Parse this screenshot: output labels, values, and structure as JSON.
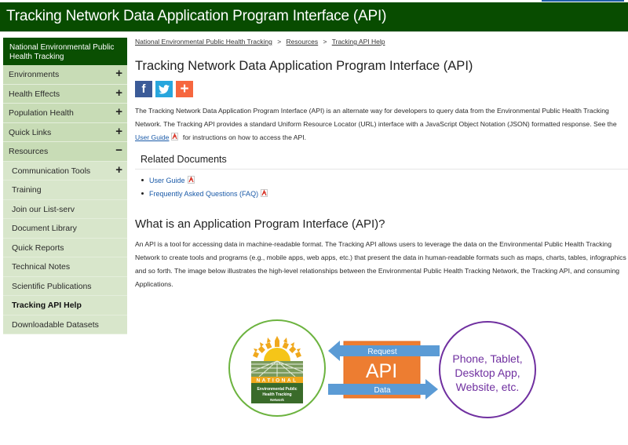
{
  "header": {
    "title": "Tracking Network Data Application Program Interface (API)"
  },
  "sidebar": {
    "heading": "National Environmental Public Health Tracking",
    "items": [
      {
        "label": "Environments",
        "sign": "+"
      },
      {
        "label": "Health Effects",
        "sign": "+"
      },
      {
        "label": "Population Health",
        "sign": "+"
      },
      {
        "label": "Quick Links",
        "sign": "+"
      },
      {
        "label": "Resources",
        "sign": "−"
      }
    ],
    "sub_items": [
      {
        "label": "Communication Tools",
        "sign": "+"
      },
      {
        "label": "Training"
      },
      {
        "label": "Join our List-serv"
      },
      {
        "label": "Document Library"
      },
      {
        "label": "Quick Reports"
      },
      {
        "label": "Technical Notes"
      },
      {
        "label": "Scientific Publications"
      },
      {
        "label": "Tracking API Help",
        "active": true
      },
      {
        "label": "Downloadable Datasets"
      }
    ]
  },
  "breadcrumb": [
    "National Environmental Public Health Tracking",
    "Resources",
    "Tracking API Help"
  ],
  "breadcrumb_sep": ">",
  "page_title": "Tracking Network Data Application Program Interface (API)",
  "social": {
    "facebook": "f",
    "twitter": "t",
    "share": "+"
  },
  "intro": {
    "before_link": "The Tracking Network Data Application Program Interface (API) is an alternate way for developers to query data from the Environmental Public Health Tracking Network. The Tracking API provides a standard Uniform Resource Locator (URL) interface with a JavaScript Object Notation (JSON) formatted response. See the ",
    "link": "User Guide",
    "after_link": " for instructions on how to access the API."
  },
  "related": {
    "title": "Related Documents",
    "items": [
      "User Guide",
      "Frequently Asked Questions (FAQ)"
    ]
  },
  "section2": {
    "title": "What is an Application Program Interface (API)?",
    "body": "An API is a tool for accessing data in machine-readable format. The Tracking API allows users to leverage the data on the Environmental Public Health Tracking Network to create tools and programs (e.g., mobile apps, web apps, etc.) that present the data in human-readable formats such as maps, charts, tables, infographics and so forth. The image below illustrates the high-level relationships between the Environmental Public Health Tracking Network, the Tracking API, and consuming Applications."
  },
  "diagram": {
    "logo_banner": "NATIONAL",
    "logo_text": [
      "Environmental Public",
      "Health Tracking",
      "Network"
    ],
    "api_label": "API",
    "request_label": "Request",
    "data_label": "Data",
    "client_text": [
      "Phone, Tablet,",
      "Desktop App,",
      "Website, etc."
    ],
    "colors": {
      "green_circle": "#6cb33f",
      "purple_circle": "#7030a0",
      "api_box": "#ed7d31",
      "arrow": "#5b9bd5",
      "logo_green": "#3a6b2a",
      "sun": "#f5c518"
    }
  }
}
